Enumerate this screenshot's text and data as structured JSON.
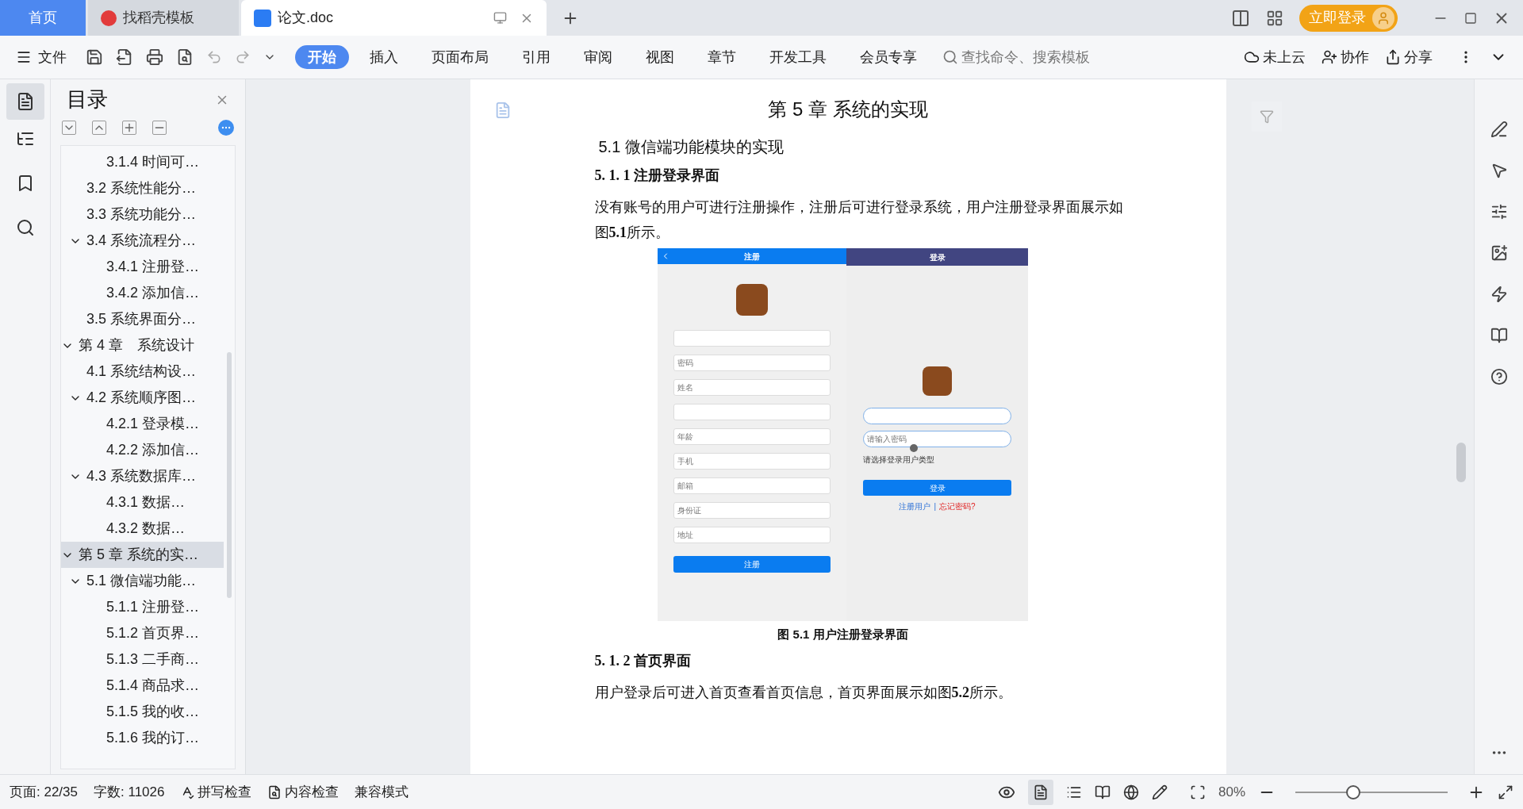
{
  "tabs": [
    {
      "label": "首页",
      "kind": "home",
      "selected": false
    },
    {
      "label": "找稻壳模板",
      "kind": "docer",
      "selected": false
    },
    {
      "label": "论文.doc",
      "kind": "doc",
      "selected": true
    }
  ],
  "login_button": "立即登录",
  "toolbar": {
    "file_menu": "文件",
    "ribbon_tabs": [
      {
        "label": "开始",
        "selected": true
      },
      {
        "label": "插入",
        "selected": false
      },
      {
        "label": "页面布局",
        "selected": false
      },
      {
        "label": "引用",
        "selected": false
      },
      {
        "label": "审阅",
        "selected": false
      },
      {
        "label": "视图",
        "selected": false
      },
      {
        "label": "章节",
        "selected": false
      },
      {
        "label": "开发工具",
        "selected": false
      },
      {
        "label": "会员专享",
        "selected": false
      }
    ],
    "search": {
      "placeholder": "查找命令、搜索模板"
    },
    "actions": [
      {
        "label": "未上云",
        "kind": "cloud"
      },
      {
        "label": "协作",
        "kind": "collab"
      },
      {
        "label": "分享",
        "kind": "share"
      }
    ]
  },
  "toc": {
    "title": "目录",
    "items": [
      {
        "children": [
          {
            "children": [
              {
                "label": "3.1.4 时间可…",
                "selected": false
              }
            ]
          },
          {
            "label": "3.2  系统性能分…",
            "selected": false
          },
          {
            "label": "3.3  系统功能分…",
            "selected": false
          },
          {
            "label": "3.4  系统流程分…",
            "selected": false,
            "expanded": true,
            "children": [
              {
                "label": "3.4.1 注册登…",
                "selected": false
              },
              {
                "label": "3.4.2 添加信…",
                "selected": false
              }
            ]
          },
          {
            "label": "3.5 系统界面分…",
            "selected": false
          }
        ]
      },
      {
        "label": "第 4 章　系统设计",
        "selected": false,
        "expanded": true,
        "children": [
          {
            "label": "4.1 系统结构设…",
            "selected": false
          },
          {
            "label": "4.2 系统顺序图…",
            "selected": false,
            "expanded": true,
            "children": [
              {
                "label": "4.2.1 登录模…",
                "selected": false
              },
              {
                "label": "4.2.2 添加信…",
                "selected": false
              }
            ]
          },
          {
            "label": "4.3 系统数据库…",
            "selected": false,
            "expanded": true,
            "children": [
              {
                "label": "4.3.1  数据…",
                "selected": false
              },
              {
                "label": "4.3.2  数据…",
                "selected": false
              }
            ]
          }
        ]
      },
      {
        "label": "第 5 章  系统的实…",
        "selected": true,
        "expanded": true,
        "children": [
          {
            "label": "5.1 微信端功能…",
            "selected": false,
            "expanded": true,
            "children": [
              {
                "label": "5.1.1 注册登…",
                "selected": false
              },
              {
                "label": "5.1.2 首页界…",
                "selected": false
              },
              {
                "label": "5.1.3 二手商…",
                "selected": false
              },
              {
                "label": "5.1.4 商品求…",
                "selected": false
              },
              {
                "label": "5.1.5 我的收…",
                "selected": false
              },
              {
                "label": "5.1.6 我的订…",
                "selected": false
              }
            ]
          }
        ]
      }
    ]
  },
  "document": {
    "chapter_title": "第 5 章  系统的实现",
    "section_title": "5.1 微信端功能模块的实现",
    "blocks": [
      {
        "kind": "heading",
        "text": "5. 1. 1 注册登录界面"
      },
      {
        "kind": "paragraph",
        "text": "没有账号的用户可进行注册操作，注册后可进行登录系统，用户注册登录界面展示如图**5.1**所示。"
      },
      {
        "kind": "figure",
        "caption": "图 5.1  用户注册登录界面",
        "register": {
          "title": "注册",
          "fields": [
            {
              "kind": "blank"
            },
            {
              "kind": "hint",
              "placeholder": "密码"
            },
            {
              "kind": "hint",
              "placeholder": "姓名"
            },
            {
              "kind": "blank"
            },
            {
              "kind": "hint",
              "placeholder": "年龄"
            },
            {
              "kind": "hint",
              "placeholder": "手机"
            },
            {
              "kind": "hint",
              "placeholder": "邮箱"
            },
            {
              "kind": "hint",
              "placeholder": "身份证"
            },
            {
              "kind": "hint",
              "placeholder": "地址"
            }
          ],
          "button": "注册"
        },
        "login": {
          "title": "登录",
          "fields": [
            {
              "kind": "blank"
            },
            {
              "kind": "hint",
              "placeholder": "请输入密码"
            }
          ],
          "hint": "请选择登录用户类型",
          "button": "登录",
          "register_link": "注册用户",
          "separator": "|",
          "forgot_link": "忘记密码?"
        }
      },
      {
        "kind": "heading",
        "text": "5. 1. 2 首页界面"
      },
      {
        "kind": "paragraph",
        "text": "用户登录后可进入首页查看首页信息，首页界面展示如图**5.2**所示。"
      }
    ]
  },
  "status_bar": {
    "page": "页面: 22/35",
    "words": "字数: 11026",
    "spell_check": "拼写检查",
    "content_check": "内容检查",
    "mode": "兼容模式",
    "zoom": "80%",
    "zoom_slider": {
      "level": 0.38
    }
  }
}
